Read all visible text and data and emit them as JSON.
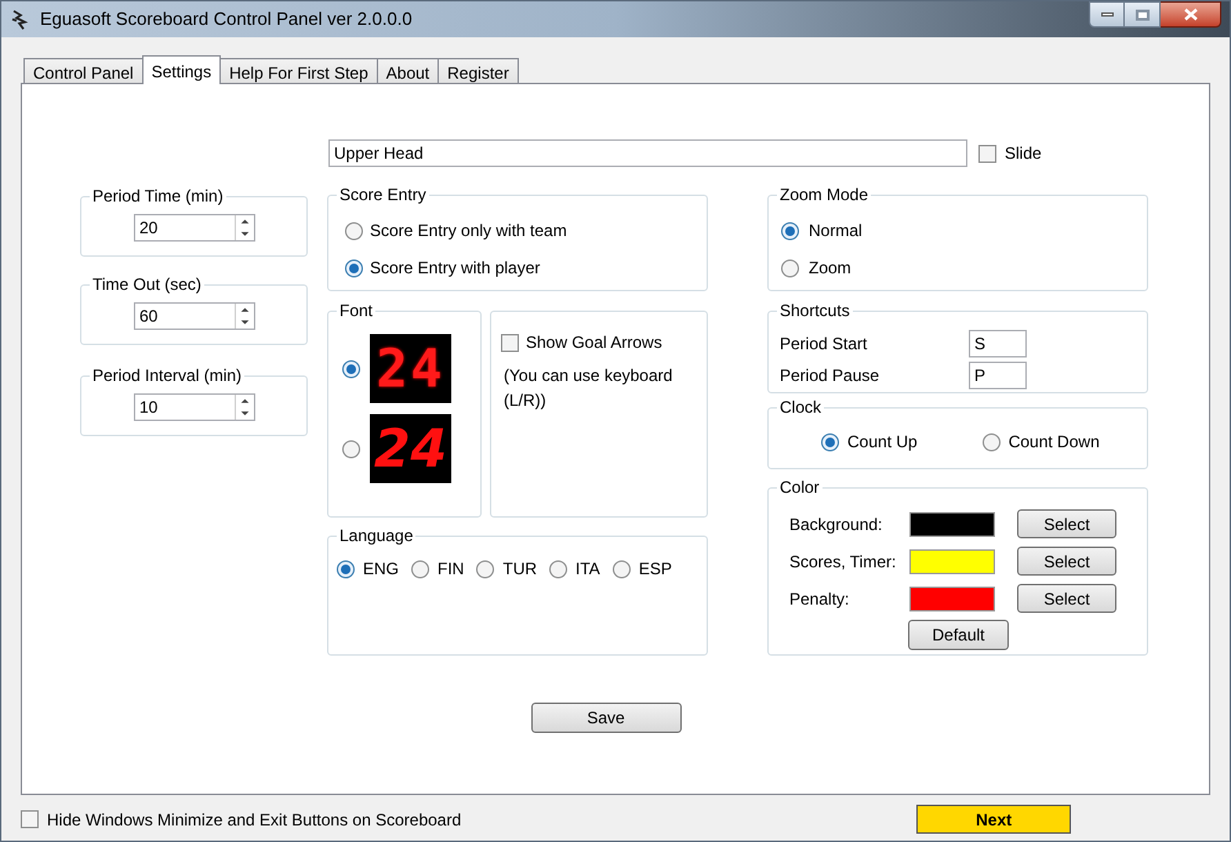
{
  "window": {
    "title": "Eguasoft Scoreboard Control Panel ver 2.0.0.0"
  },
  "tabs": [
    {
      "label": "Control Panel",
      "selected": false
    },
    {
      "label": "Settings",
      "selected": true
    },
    {
      "label": "Help For First Step",
      "selected": false
    },
    {
      "label": "About",
      "selected": false
    },
    {
      "label": "Register",
      "selected": false
    }
  ],
  "upper_head": {
    "value": "Upper Head"
  },
  "slide": {
    "label": "Slide",
    "checked": false
  },
  "timers": [
    {
      "label": "Period Time (min)",
      "value": "20"
    },
    {
      "label": "Time Out (sec)",
      "value": "60"
    },
    {
      "label": "Period Interval (min)",
      "value": "10"
    }
  ],
  "score_entry": {
    "title": "Score Entry",
    "options": [
      {
        "label": "Score Entry only with team",
        "selected": false
      },
      {
        "label": "Score Entry with player",
        "selected": true
      }
    ]
  },
  "font": {
    "title": "Font",
    "options": [
      {
        "preview": "24",
        "kind": "dot-matrix",
        "selected": true
      },
      {
        "preview": "24",
        "kind": "segment",
        "selected": false
      }
    ]
  },
  "goal_arrows": {
    "label": "Show Goal Arrows",
    "checked": false,
    "note": "(You can use keyboard (L/R))"
  },
  "language": {
    "title": "Language",
    "options": [
      {
        "label": "ENG",
        "selected": true
      },
      {
        "label": "FIN",
        "selected": false
      },
      {
        "label": "TUR",
        "selected": false
      },
      {
        "label": "ITA",
        "selected": false
      },
      {
        "label": "ESP",
        "selected": false
      }
    ]
  },
  "zoom_mode": {
    "title": "Zoom Mode",
    "options": [
      {
        "label": "Normal",
        "selected": true
      },
      {
        "label": "Zoom",
        "selected": false
      }
    ]
  },
  "shortcuts": {
    "title": "Shortcuts",
    "items": [
      {
        "label": "Period Start",
        "value": "S"
      },
      {
        "label": "Period Pause",
        "value": "P"
      }
    ]
  },
  "clock": {
    "title": "Clock",
    "options": [
      {
        "label": "Count Up",
        "selected": true
      },
      {
        "label": "Count Down",
        "selected": false
      }
    ]
  },
  "color": {
    "title": "Color",
    "items": [
      {
        "label": "Background:",
        "color": "#000000",
        "button": "Select"
      },
      {
        "label": "Scores, Timer:",
        "color": "#ffff00",
        "button": "Select"
      },
      {
        "label": "Penalty:",
        "color": "#ff0000",
        "button": "Select"
      }
    ],
    "default_button": "Default"
  },
  "save_button": "Save",
  "hide_buttons": {
    "label": "Hide Windows Minimize and Exit Buttons on Scoreboard",
    "checked": false
  },
  "next_button": "Next"
}
